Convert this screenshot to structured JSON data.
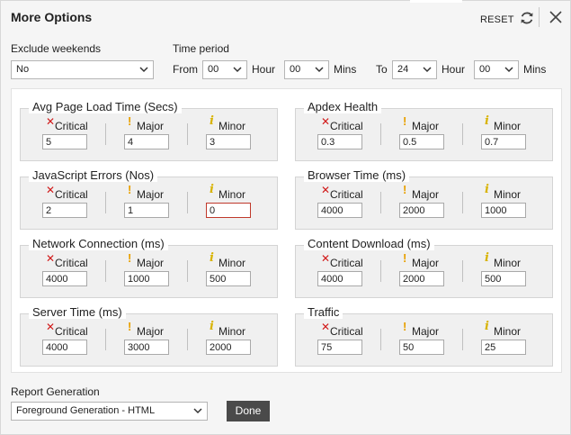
{
  "dialog": {
    "title": "More Options",
    "reset_label": "RESET"
  },
  "options": {
    "exclude_weekends": {
      "label": "Exclude weekends",
      "value": "No"
    },
    "time_period": {
      "label": "Time period",
      "from_label": "From",
      "from_hour": "00",
      "hour_label": "Hour",
      "from_min": "00",
      "mins_label": "Mins",
      "to_label": "To",
      "to_hour": "24",
      "to_hour_label": "Hour",
      "to_min": "00",
      "to_mins_label": "Mins"
    }
  },
  "severity_labels": {
    "critical": "Critical",
    "major": "Major",
    "minor": "Minor"
  },
  "groups": [
    {
      "title": "Avg Page Load Time (Secs)",
      "critical": "5",
      "major": "4",
      "minor": "3"
    },
    {
      "title": "Apdex Health",
      "critical": "0.3",
      "major": "0.5",
      "minor": "0.7"
    },
    {
      "title": "JavaScript Errors (Nos)",
      "critical": "2",
      "major": "1",
      "minor": "0"
    },
    {
      "title": "Browser Time (ms)",
      "critical": "4000",
      "major": "2000",
      "minor": "1000"
    },
    {
      "title": "Network Connection (ms)",
      "critical": "4000",
      "major": "1000",
      "minor": "500"
    },
    {
      "title": "Content Download (ms)",
      "critical": "4000",
      "major": "2000",
      "minor": "500"
    },
    {
      "title": "Server Time (ms)",
      "critical": "4000",
      "major": "3000",
      "minor": "2000"
    },
    {
      "title": "Traffic",
      "critical": "75",
      "major": "50",
      "minor": "25"
    }
  ],
  "report": {
    "label": "Report Generation",
    "value": "Foreground Generation - HTML"
  },
  "done_label": "Done"
}
